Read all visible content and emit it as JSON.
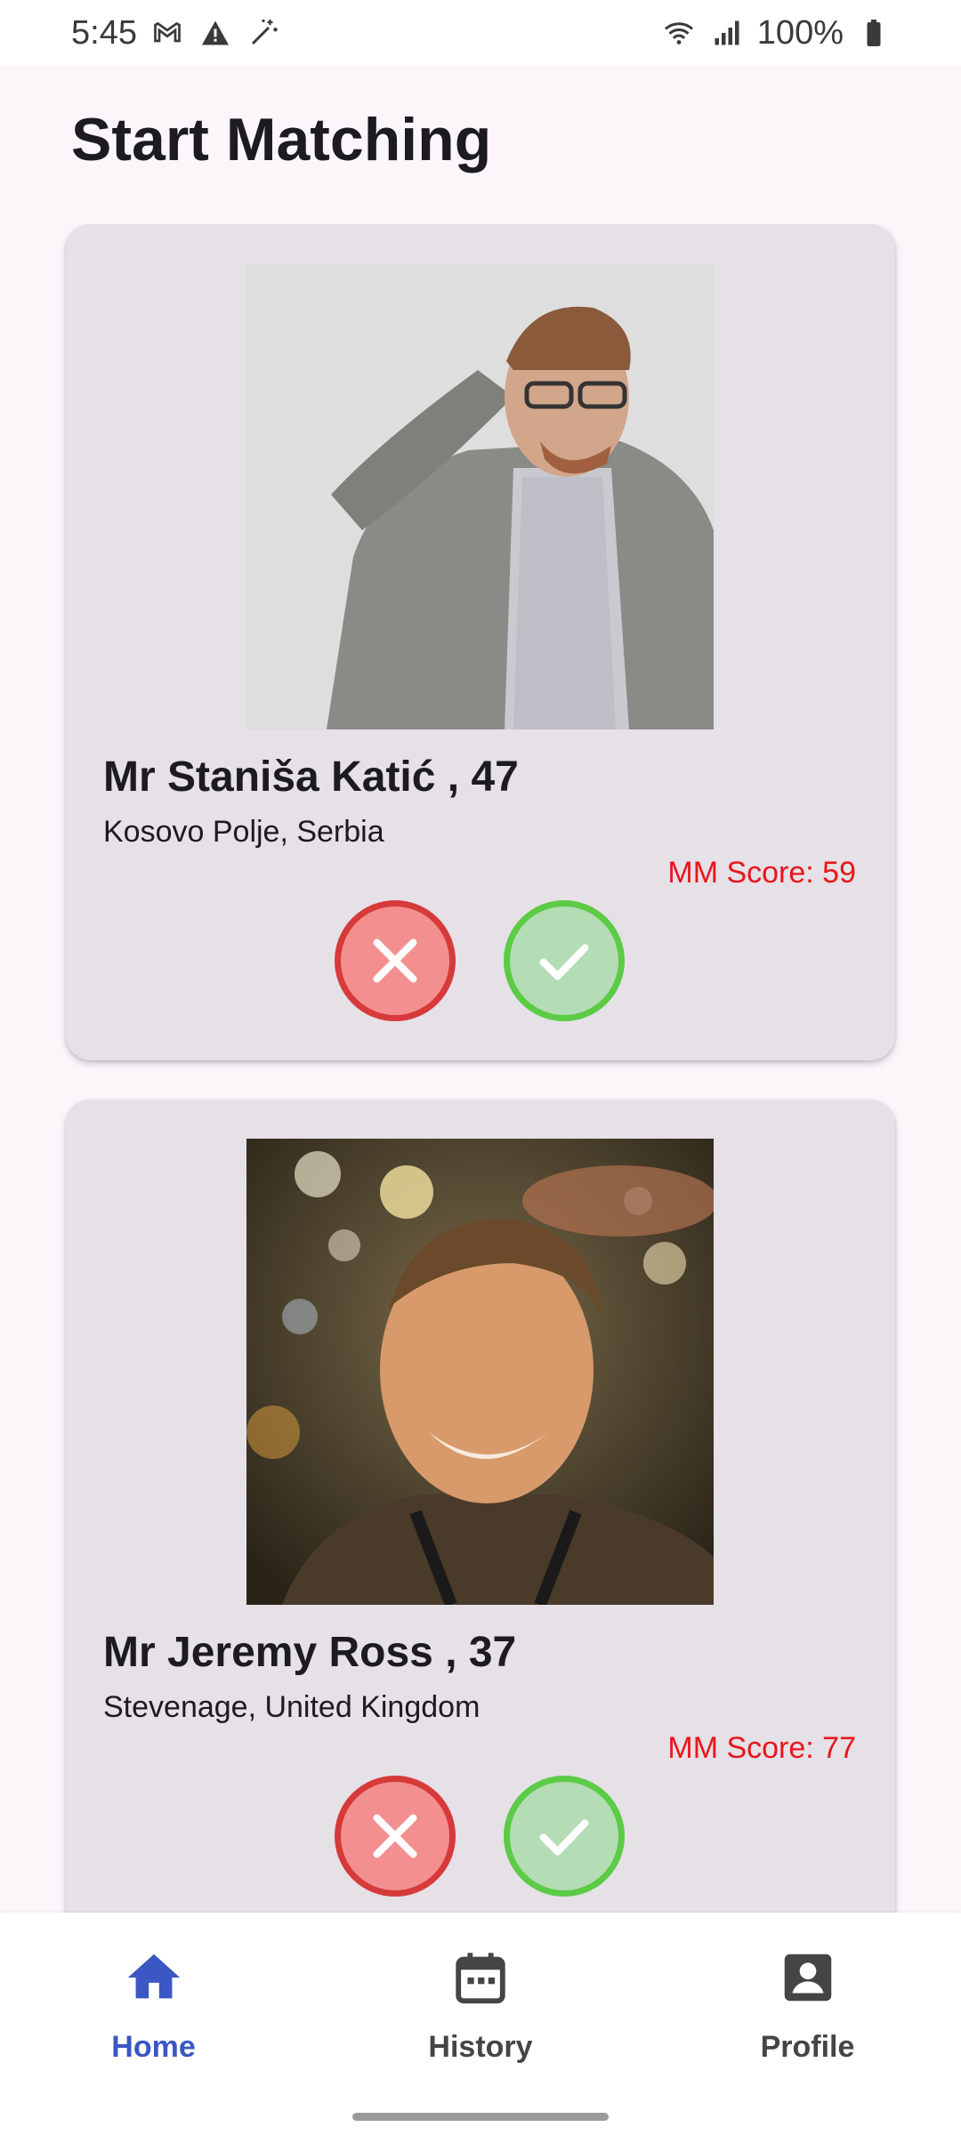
{
  "status_bar": {
    "time": "5:45",
    "battery": "100%",
    "icons": [
      "gmail-icon",
      "warning-icon",
      "magic-wand-icon",
      "wifi-icon",
      "signal-icon",
      "battery-icon"
    ]
  },
  "page": {
    "title": "Start Matching"
  },
  "matches": [
    {
      "name": "Mr Staniša Katić , 47",
      "location": "Kosovo Polje, Serbia",
      "score": "MM Score: 59"
    },
    {
      "name": "Mr Jeremy Ross , 37",
      "location": "Stevenage, United Kingdom",
      "score": "MM Score: 77"
    }
  ],
  "nav": {
    "items": [
      {
        "label": "Home",
        "icon": "home-icon",
        "active": true
      },
      {
        "label": "History",
        "icon": "calendar-icon",
        "active": false
      },
      {
        "label": "Profile",
        "icon": "profile-icon",
        "active": false
      }
    ]
  },
  "colors": {
    "accent": "#3b57c4",
    "reject": "#d73a3a",
    "accept": "#5ccb46",
    "score": "#e8161b",
    "card": "#e6e0e7"
  }
}
